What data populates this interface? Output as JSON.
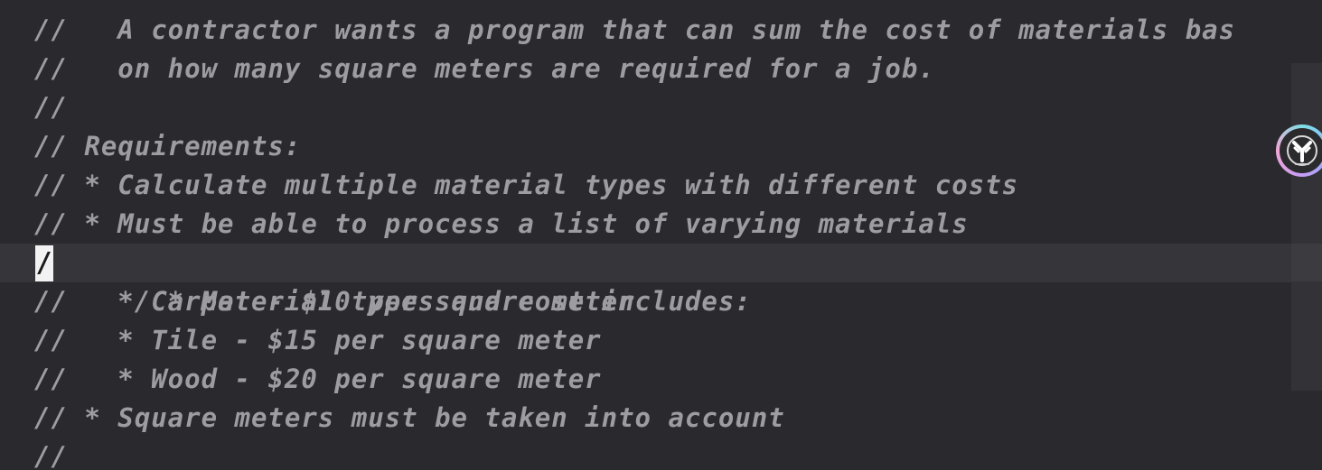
{
  "editor": {
    "lines": [
      "//   A contractor wants a program that can sum the cost of materials bas",
      "//   on how many square meters are required for a job.",
      "//",
      "// Requirements:",
      "// * Calculate multiple material types with different costs",
      "// * Must be able to process a list of varying materials",
      "/ * Material types and cost includes:",
      "//   * Carpet - $10 per square meter",
      "//   * Tile - $15 per square meter",
      "//   * Wood - $20 per square meter",
      "// * Square meters must be taken into account",
      "//"
    ],
    "cursor_char": "/",
    "current_line_index": 6
  },
  "assistant_badge": {
    "icon": "assistant-icon"
  },
  "colors": {
    "background": "#2a292d",
    "comment_text": "#9d9ca1",
    "current_line": "#36353a",
    "cursor": "#f2f2f2"
  }
}
